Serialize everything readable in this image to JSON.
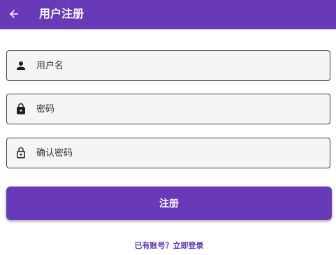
{
  "app_bar": {
    "title": "用户注册",
    "back_icon": "arrow-left-icon",
    "background": "#673ab7"
  },
  "form": {
    "username": {
      "placeholder": "用户名",
      "value": "",
      "icon": "person-icon"
    },
    "password": {
      "placeholder": "密码",
      "value": "",
      "icon": "lock-icon"
    },
    "confirm_password": {
      "placeholder": "确认密码",
      "value": "",
      "icon": "lock-outline-icon"
    }
  },
  "submit": {
    "label": "注册"
  },
  "login_link": {
    "label": "已有账号？立即登录"
  },
  "colors": {
    "accent": "#673ab7",
    "link": "#5e35b1",
    "field_bg": "#f5f5f5"
  }
}
